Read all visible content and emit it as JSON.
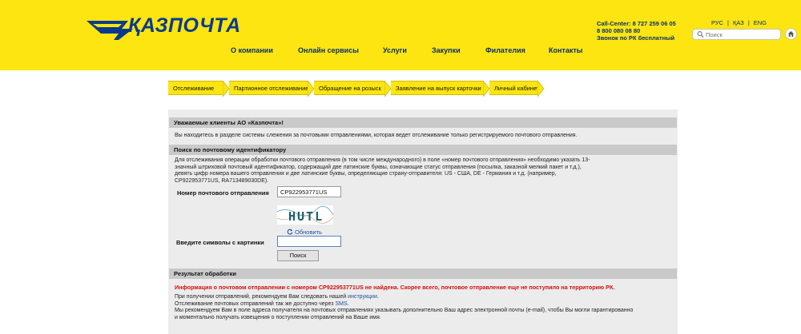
{
  "header": {
    "logo_text": "ҚАЗПОЧТА",
    "nav": [
      "О компании",
      "Онлайн сервисы",
      "Услуги",
      "Закупки",
      "Филателия",
      "Контакты"
    ],
    "callcenter": [
      "Call-Center: 8 727 259 06 05",
      "8 800 080 08 80",
      "Звонок по РК бесплатный"
    ],
    "lang": [
      "РУС",
      "ҚАЗ",
      "ENG"
    ],
    "search_placeholder": "Поиск"
  },
  "steps": [
    "Отслеживание",
    "Партионное отслеживание",
    "Обращение на розыск",
    "Заявление на выпуск карточки",
    "Личный кабинет"
  ],
  "welcome": {
    "title": "Уважаемые клиенты АО «Казпочта»!",
    "text": "Вы находитесь в разделе системы слежения за почтовыми отправлениями, которая ведет отслеживание только регистрируемого почтового отправления."
  },
  "search_section": {
    "title": "Поиск по почтовому идентификатору",
    "instructions": [
      "Для отслеживания операции обработки почтового отправления (в том числе международного) в поле «номер почтового отправления» необходимо указать 13-",
      "значный штриховой почтовый идентификатор, содержащий две латинские буквы, означающие статус отправления (посылка, заказной мелкий пакет и т.д.),",
      "девять цифр номера вашего отправления и две латинские буквы, определяющие страну-отправителя: US - США, DE - Германия и т.д. (например,",
      "CP922953771US, RA713489030DE)."
    ],
    "tracking_label": "Номер почтового отправления",
    "tracking_value": "CP922953771US",
    "captcha_text": "HUTL",
    "refresh_label": "Обновить",
    "captcha_label": "Введите символы с картинки",
    "captcha_value": "",
    "search_button": "Поиск"
  },
  "result_section": {
    "title": "Результат обработки",
    "error": "Информация о почтовом отправлении с номером CP922953771US не найдена. Скорее всего, почтовое отправление еще не поступило на территорию РК.",
    "line1_before": "При получении отправлений, рекомендуем Вам следовать нашей ",
    "line1_link": "инструкции",
    "line1_after": ".",
    "line2_before": "Отслеживание почтовых отправлений так же доступно через ",
    "line2_link": "SMS",
    "line2_after": ".",
    "line3": "Мы рекомендуем Вам в поле адреса получателя на почтовых отправлениях указывать дополнительно Ваш адрес электронной почты (e-mail), чтобы Вы могли гарантированно",
    "line4": "и моментально получать извещения о поступлении отправлений на Ваше имя."
  },
  "colors": {
    "brand_yellow": "#fce510",
    "brand_blue": "#0a3a8f",
    "error_red": "#d11010"
  }
}
